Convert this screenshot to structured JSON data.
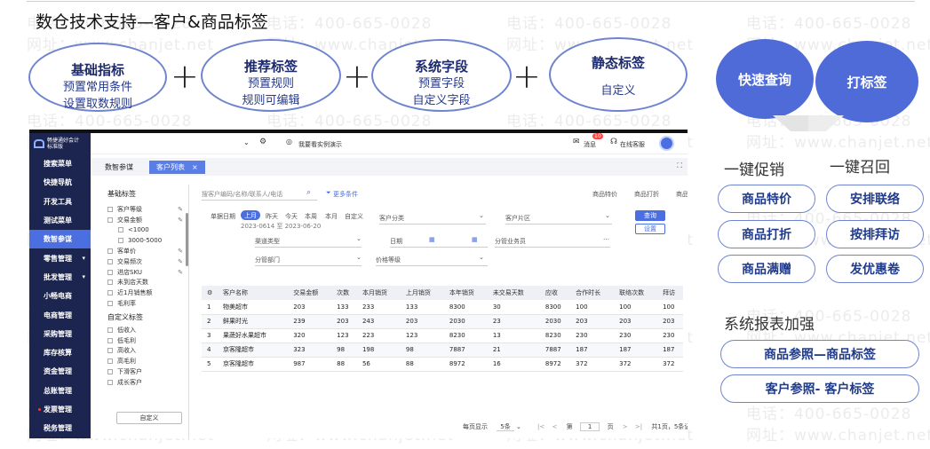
{
  "title": "数仓技术支持—客户&商品标签",
  "watermark": {
    "phone": "电话：400-665-0028",
    "site": "网址：www.chanjet.net"
  },
  "pills": [
    {
      "title": "基础指标",
      "lines": [
        "预置常用条件",
        "设置取数规则"
      ]
    },
    {
      "title": "推荐标签",
      "lines": [
        "预置规则",
        "规则可编辑"
      ]
    },
    {
      "title": "系统字段",
      "lines": [
        "预置字段",
        "自定义字段"
      ]
    },
    {
      "title": "静态标签",
      "lines": [
        "自定义"
      ]
    }
  ],
  "plus": "+",
  "actions": {
    "quick_query": "快速查询",
    "tagging": "打标签"
  },
  "promo": {
    "left_label": "一键促销",
    "right_label": "一键召回",
    "left_buttons": [
      "商品特价",
      "商品打折",
      "商品满赠"
    ],
    "right_buttons": [
      "安排联络",
      "按排拜访",
      "发优惠卷"
    ]
  },
  "report": {
    "label": "系统报表加强",
    "buttons": [
      "商品参照—商品标签",
      "客户参照- 客户标签"
    ]
  },
  "app": {
    "logo_text": [
      "畅捷通好会计",
      "标准版"
    ],
    "sidebar": [
      "搜索菜单",
      "快捷导航",
      "开发工具",
      "测试菜单",
      "数智参谋",
      "零售管理",
      "批发管理",
      "小畅电商",
      "电商管理",
      "采购管理",
      "库存核算",
      "资金管理",
      "总账管理",
      "发票管理",
      "税务管理"
    ],
    "sidebar_active": 4,
    "topbar_company": "我要看实例演示",
    "topbar_msg": "消息",
    "topbar_msg_count": "10",
    "topbar_service": "在线客服",
    "tabs": [
      "数智参谋",
      "客户列表"
    ],
    "tab_close": "×",
    "left_panel": {
      "basic_head": "基础标签",
      "basic_items": [
        "客户等级",
        "交易金额",
        "<1000",
        "3000-5000",
        "客单价",
        "交易频次",
        "进店SKU",
        "未到店天数",
        "近1月销售额",
        "毛利率"
      ],
      "custom_head": "自定义标签",
      "custom_items": [
        "低收入",
        "低毛利",
        "高收入",
        "高毛利",
        "下滑客户",
        "成长客户"
      ],
      "button": "自定义"
    },
    "search": {
      "placeholder": "搜客户编码/名称/联系人/电话",
      "more": "更多条件",
      "tools": [
        "商品特价",
        "商品打折",
        "商品满赠"
      ]
    },
    "filters": {
      "date_label": "单据日期",
      "date_opts": [
        "上月",
        "昨天",
        "今天",
        "本周",
        "本月",
        "自定义"
      ],
      "date_range": "2023-0614 至 2023-06-20",
      "customer_category": "客户分类",
      "customer_region": "客户片区",
      "channel_type": "渠道类型",
      "date": "日期",
      "salesperson": "分管业务员",
      "department": "分管部门",
      "price_level": "价格等级",
      "query": "查询",
      "settings": "设置"
    },
    "table": {
      "columns": [
        "客户名称",
        "交易金额",
        "次数",
        "本月销货",
        "上月销货",
        "本年销货",
        "未交易天数",
        "应收",
        "合作时长",
        "联络次数",
        "拜访"
      ],
      "rows": [
        [
          "1",
          "物美超市",
          "203",
          "133",
          "233",
          "133",
          "8300",
          "30",
          "8300",
          "100",
          "100",
          "100"
        ],
        [
          "2",
          "鲜果时光",
          "239",
          "203",
          "243",
          "203",
          "2030",
          "23",
          "2030",
          "203",
          "203",
          "203"
        ],
        [
          "3",
          "果蔬好水果超市",
          "320",
          "123",
          "223",
          "123",
          "8230",
          "13",
          "8230",
          "230",
          "230",
          "230"
        ],
        [
          "4",
          "京客隆超市",
          "323",
          "98",
          "198",
          "98",
          "7887",
          "21",
          "7887",
          "187",
          "187",
          "187"
        ],
        [
          "5",
          "京客隆超市",
          "987",
          "88",
          "56",
          "88",
          "8972",
          "16",
          "8972",
          "372",
          "372",
          "372"
        ]
      ]
    },
    "pager": {
      "per_page_label": "每页显示",
      "per_page": "5条",
      "page_prefix": "第",
      "page": "1",
      "page_suffix": "页",
      "summary": "共1页，5条记录"
    }
  }
}
